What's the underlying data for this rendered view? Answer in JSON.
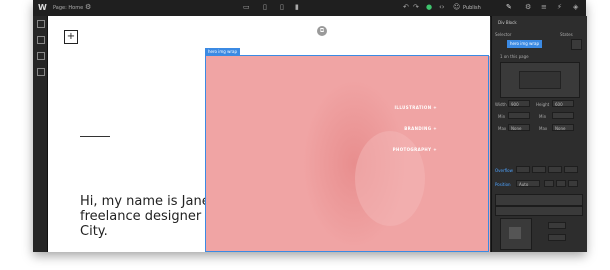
{
  "app": {
    "logo": "W",
    "page_label": "Page: Home",
    "publish_label": "Publish"
  },
  "canvas": {
    "headline": "Hi, my name is Janet, and I'm a freelance designer in New York City.",
    "hero_label": "hero img wrap",
    "nav": [
      "ILLUSTRATION +",
      "BRANDING +",
      "PHOTOGRAPHY +"
    ]
  },
  "panel": {
    "title": "Div Block",
    "selector_label": "Selector",
    "states_label": "States",
    "selector_value": "hero img wrap",
    "on_page": "1 on this page",
    "width_label": "Width",
    "width_value": "900",
    "height_label": "Height",
    "height_value": "600",
    "min_label": "Min",
    "max_label": "Max",
    "none_value": "None",
    "overflow_label": "Overflow",
    "position_label": "Position",
    "position_value": "Auto"
  },
  "colors": {
    "accent": "#3b8ae3",
    "hero_pink": "#f0a4a4",
    "chrome": "#2b2b2b"
  }
}
